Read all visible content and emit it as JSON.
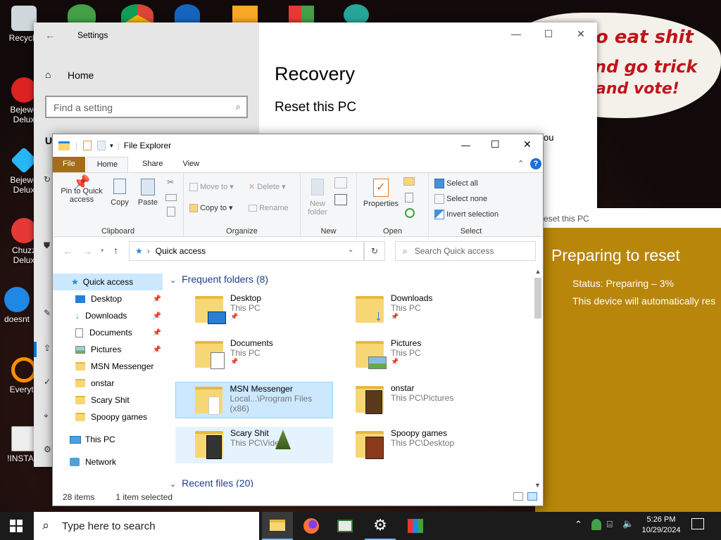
{
  "desktop": {
    "icons": [
      {
        "label": "Recycle"
      },
      {
        "label": "Bejewe Delux"
      },
      {
        "label": "Bejewe Delux"
      },
      {
        "label": "Chuzz Delux"
      },
      {
        "label": "doesnt"
      },
      {
        "label": "Everyth"
      },
      {
        "label": "!INSTALI"
      }
    ],
    "wallpaper_text": [
      "o eat shit",
      "nd go trick",
      "and vote!"
    ]
  },
  "settings": {
    "title": "Settings",
    "home_label": "Home",
    "search_placeholder": "Find a setting",
    "page_title": "Recovery",
    "section_title": "Reset this PC",
    "partial_left": "U",
    "partial_right": "ou"
  },
  "reset_dialog": {
    "title": "eset this PC",
    "heading": "Preparing to reset",
    "status": "Status: Preparing – 3%",
    "note": "This device will automatically res",
    "progress_percent": 3
  },
  "explorer": {
    "title": "File Explorer",
    "tabs": [
      "File",
      "Home",
      "Share",
      "View"
    ],
    "ribbon": {
      "clipboard": {
        "label": "Clipboard",
        "pin": "Pin to Quick access",
        "copy": "Copy",
        "paste": "Paste"
      },
      "organize": {
        "label": "Organize",
        "move_to": "Move to",
        "copy_to": "Copy to",
        "delete": "Delete",
        "rename": "Rename"
      },
      "new": {
        "label": "New",
        "new_folder": "New folder"
      },
      "open": {
        "label": "Open",
        "properties": "Properties"
      },
      "select": {
        "label": "Select",
        "select_all": "Select all",
        "select_none": "Select none",
        "invert": "Invert selection"
      }
    },
    "address": "Quick access",
    "search_placeholder": "Search Quick access",
    "nav": [
      {
        "label": "Quick access",
        "pinned": false
      },
      {
        "label": "Desktop",
        "pinned": true
      },
      {
        "label": "Downloads",
        "pinned": true
      },
      {
        "label": "Documents",
        "pinned": true
      },
      {
        "label": "Pictures",
        "pinned": true
      },
      {
        "label": "MSN Messenger",
        "pinned": false
      },
      {
        "label": "onstar",
        "pinned": false
      },
      {
        "label": "Scary Shit",
        "pinned": false
      },
      {
        "label": "Spoopy games",
        "pinned": false
      },
      {
        "label": "This PC",
        "pinned": false
      },
      {
        "label": "Network",
        "pinned": false
      }
    ],
    "frequent_header": "Frequent folders (8)",
    "recent_header": "Recent files (20)",
    "folders": [
      {
        "name": "Desktop",
        "location": "This PC"
      },
      {
        "name": "Downloads",
        "location": "This PC"
      },
      {
        "name": "Documents",
        "location": "This PC"
      },
      {
        "name": "Pictures",
        "location": "This PC"
      },
      {
        "name": "MSN Messenger",
        "location": "Local...\\Program Files (x86)"
      },
      {
        "name": "onstar",
        "location": "This PC\\Pictures"
      },
      {
        "name": "Scary Shit",
        "location": "This PC\\Video"
      },
      {
        "name": "Spoopy games",
        "location": "This PC\\Desktop"
      }
    ],
    "status_items": "28 items",
    "status_selected": "1 item selected"
  },
  "taskbar": {
    "search_placeholder": "Type here to search",
    "time": "5:26 PM",
    "date": "10/29/2024"
  }
}
